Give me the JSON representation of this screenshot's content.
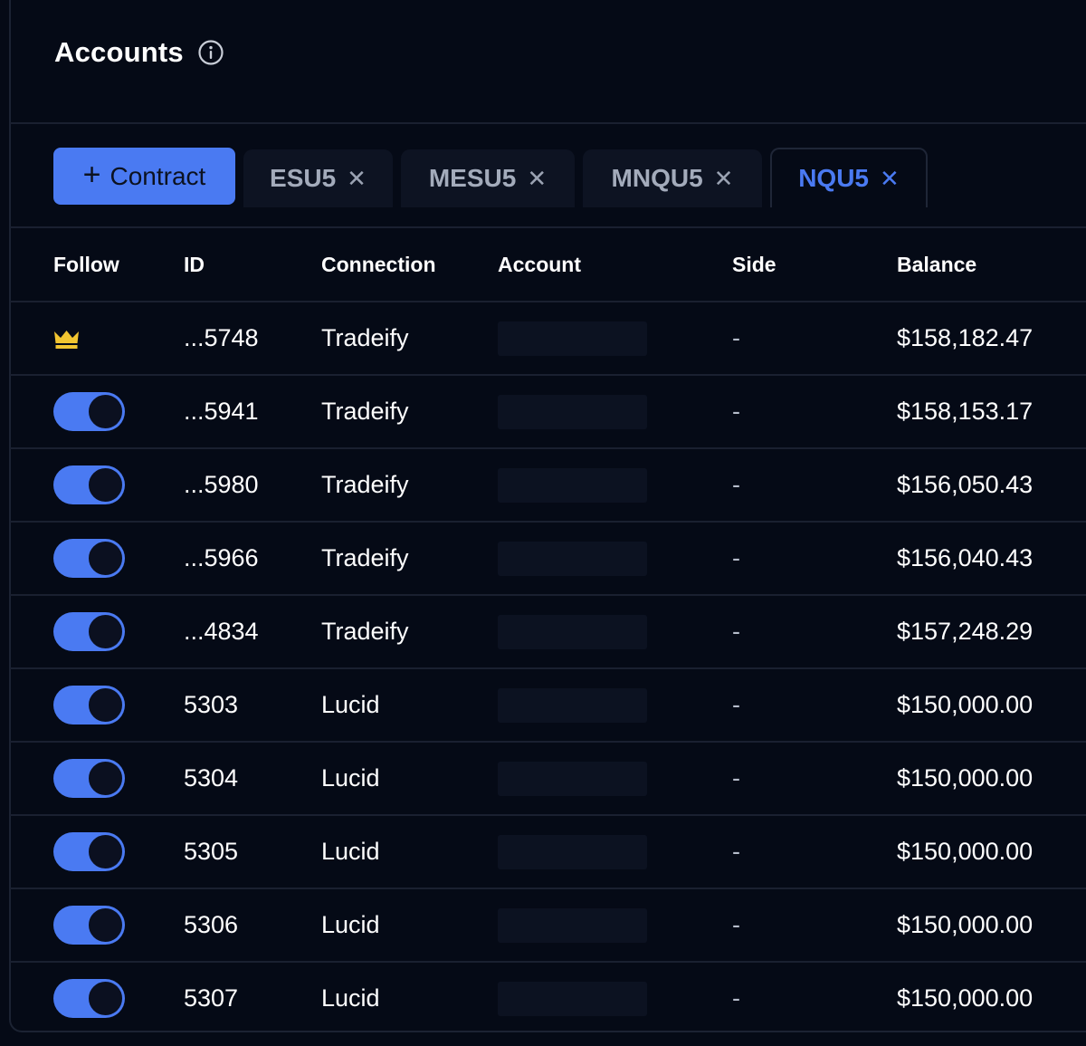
{
  "header": {
    "title": "Accounts"
  },
  "toolbar": {
    "add_label": "Contract",
    "add_symbol": "+"
  },
  "tabs": [
    {
      "label": "ESU5",
      "active": false
    },
    {
      "label": "MESU5",
      "active": false
    },
    {
      "label": "MNQU5",
      "active": false
    },
    {
      "label": "NQU5",
      "active": true
    }
  ],
  "table": {
    "columns": [
      "Follow",
      "ID",
      "Connection",
      "Account",
      "Side",
      "Balance"
    ],
    "rows": [
      {
        "follow": "leader",
        "id": "...5748",
        "connection": "Tradeify",
        "side": "-",
        "balance": "$158,182.47"
      },
      {
        "follow": "on",
        "id": "...5941",
        "connection": "Tradeify",
        "side": "-",
        "balance": "$158,153.17"
      },
      {
        "follow": "on",
        "id": "...5980",
        "connection": "Tradeify",
        "side": "-",
        "balance": "$156,050.43"
      },
      {
        "follow": "on",
        "id": "...5966",
        "connection": "Tradeify",
        "side": "-",
        "balance": "$156,040.43"
      },
      {
        "follow": "on",
        "id": "...4834",
        "connection": "Tradeify",
        "side": "-",
        "balance": "$157,248.29"
      },
      {
        "follow": "on",
        "id": "5303",
        "connection": "Lucid",
        "side": "-",
        "balance": "$150,000.00"
      },
      {
        "follow": "on",
        "id": "5304",
        "connection": "Lucid",
        "side": "-",
        "balance": "$150,000.00"
      },
      {
        "follow": "on",
        "id": "5305",
        "connection": "Lucid",
        "side": "-",
        "balance": "$150,000.00"
      },
      {
        "follow": "on",
        "id": "5306",
        "connection": "Lucid",
        "side": "-",
        "balance": "$150,000.00"
      },
      {
        "follow": "on",
        "id": "5307",
        "connection": "Lucid",
        "side": "-",
        "balance": "$150,000.00"
      }
    ]
  },
  "icons": {
    "info": "info-circle-icon",
    "leader": "crown-icon",
    "close": "close-icon",
    "add": "plus-icon"
  },
  "colors": {
    "background": "#050a16",
    "accent": "#4a7af2",
    "crown": "#f2c531",
    "muted_text": "#a3abbb"
  }
}
